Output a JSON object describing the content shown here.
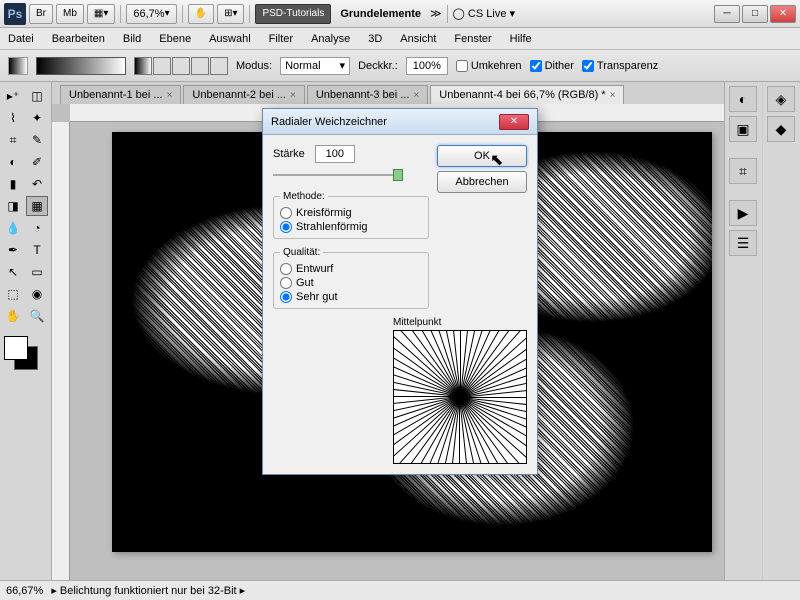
{
  "titlebar": {
    "br": "Br",
    "mb": "Mb",
    "zoom": "66,7%",
    "brand": "PSD-Tutorials",
    "workspace": "Grundelemente",
    "cslive": "CS Live"
  },
  "menu": [
    "Datei",
    "Bearbeiten",
    "Bild",
    "Ebene",
    "Auswahl",
    "Filter",
    "Analyse",
    "3D",
    "Ansicht",
    "Fenster",
    "Hilfe"
  ],
  "optbar": {
    "modus_label": "Modus:",
    "modus_val": "Normal",
    "deck_label": "Deckkr.:",
    "deck_val": "100%",
    "umkehren": "Umkehren",
    "dither": "Dither",
    "transparenz": "Transparenz"
  },
  "tabs": [
    {
      "label": "Unbenannt-1 bei ...",
      "active": false
    },
    {
      "label": "Unbenannt-2 bei ...",
      "active": false
    },
    {
      "label": "Unbenannt-3 bei ...",
      "active": false
    },
    {
      "label": "Unbenannt-4 bei 66,7% (RGB/8) *",
      "active": true
    }
  ],
  "status": {
    "zoom": "66,67%",
    "msg": "Belichtung funktioniert nur bei 32-Bit"
  },
  "dialog": {
    "title": "Radialer Weichzeichner",
    "strength_label": "Stärke",
    "strength_val": "100",
    "method_label": "Methode:",
    "method_opts": [
      "Kreisförmig",
      "Strahlenförmig"
    ],
    "method_sel": 1,
    "quality_label": "Qualität:",
    "quality_opts": [
      "Entwurf",
      "Gut",
      "Sehr gut"
    ],
    "quality_sel": 2,
    "preview_label": "Mittelpunkt",
    "ok": "OK",
    "cancel": "Abbrechen"
  }
}
